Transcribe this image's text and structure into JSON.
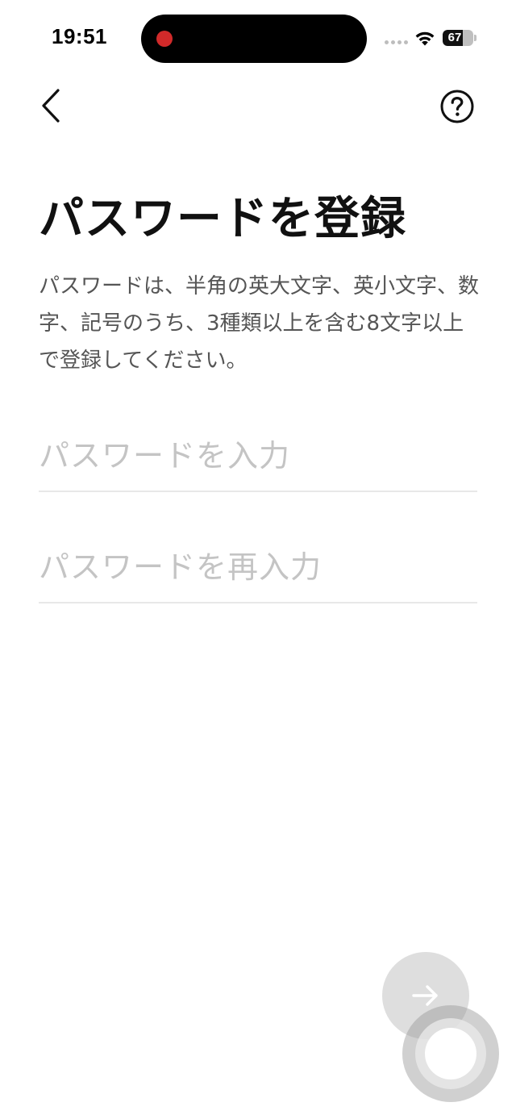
{
  "status_bar": {
    "time": "19:51",
    "battery_level": "67",
    "battery_fraction": 0.67,
    "recording_color": "#d12a2a"
  },
  "nav": {
    "back_icon": "chevron-left-icon",
    "help_icon": "question-circle-icon"
  },
  "main": {
    "title": "パスワードを登録",
    "description": "パスワードは、半角の英大文字、英小文字、数字、記号のうち、3種類以上を含む8文字以上で登録してください。",
    "password_field": {
      "value": "",
      "placeholder": "パスワードを入力"
    },
    "confirm_field": {
      "value": "",
      "placeholder": "パスワードを再入力"
    }
  },
  "next_button": {
    "icon": "arrow-right-icon",
    "enabled": false
  },
  "assistive_touch": {
    "icon": "assistive-touch-icon"
  }
}
